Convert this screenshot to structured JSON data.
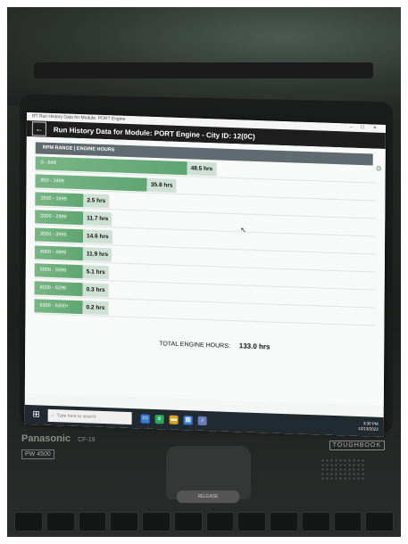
{
  "window": {
    "title_bar_text": "RT Run History Data for Module: PORT Engine",
    "controls": "– ☐ ✕"
  },
  "header": {
    "back_icon": "←",
    "title": "Run History Data for Module: PORT Engine - City ID: 12(0C)"
  },
  "table": {
    "column_header": "RPM RANGE | ENGINE HOURS",
    "rows": [
      {
        "range": "0 - 849",
        "hours": "48.5 hrs",
        "value": 48.5
      },
      {
        "range": "850 - 1499",
        "hours": "35.8 hrs",
        "value": 35.8
      },
      {
        "range": "1500 - 1999",
        "hours": "2.5 hrs",
        "value": 2.5
      },
      {
        "range": "2000 - 2999",
        "hours": "11.7 hrs",
        "value": 11.7
      },
      {
        "range": "3000 - 3999",
        "hours": "14.6 hrs",
        "value": 14.6
      },
      {
        "range": "4000 - 4999",
        "hours": "11.9 hrs",
        "value": 11.9
      },
      {
        "range": "5000 - 5999",
        "hours": "5.1 hrs",
        "value": 5.1
      },
      {
        "range": "6000 - 6299",
        "hours": "0.3 hrs",
        "value": 0.3
      },
      {
        "range": "6300 - 6300+",
        "hours": "0.2 hrs",
        "value": 0.2
      }
    ],
    "max_value": 48.5
  },
  "total": {
    "label": "TOTAL ENGINE HOURS:",
    "value": "133.0 hrs"
  },
  "taskbar": {
    "search_placeholder": "Type here to search",
    "time": "3:30 PM",
    "date": "12/13/2023"
  },
  "device": {
    "brand": "Panasonic",
    "series": "CF-19",
    "model_badge": "PW 4500",
    "product_badge": "TOUGHBOOK",
    "release_label": "RELEASE"
  },
  "colors": {
    "bar_green": "#6aac7a",
    "header_gray": "#5f6b70",
    "app_bar": "#1e1e1e"
  }
}
